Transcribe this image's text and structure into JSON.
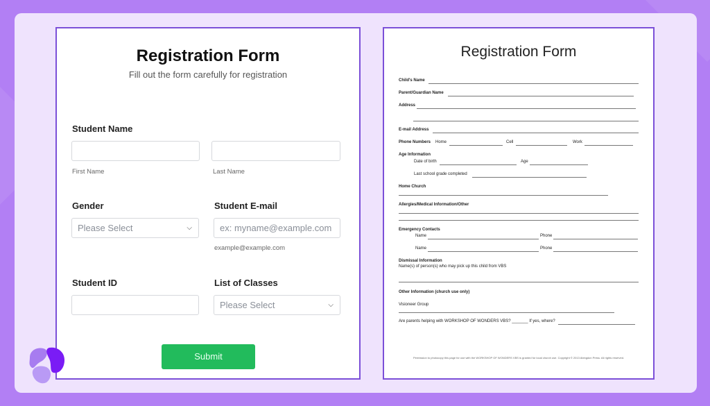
{
  "online_form": {
    "title": "Registration Form",
    "subtitle": "Fill out the form carefully for registration",
    "student_name": {
      "label": "Student Name",
      "first_hint": "First Name",
      "last_hint": "Last Name"
    },
    "gender": {
      "label": "Gender",
      "value": "Please Select"
    },
    "email": {
      "label": "Student E-mail",
      "placeholder": "ex: myname@example.com",
      "hint": "example@example.com"
    },
    "student_id": {
      "label": "Student ID"
    },
    "classes": {
      "label": "List of Classes",
      "value": "Please Select"
    },
    "submit_label": "Submit"
  },
  "paper_form": {
    "title": "Registration Form",
    "childs_name": "Child's Name",
    "guardian_name": "Parent/Guardian Name",
    "address": "Address",
    "email_address": "E-mail Address",
    "phone_numbers": "Phone Numbers",
    "home": "Home",
    "cell": "Cell",
    "work": "Work",
    "age_information": "Age Information",
    "date_of_birth": "Date of birth",
    "age": "Age",
    "last_grade": "Last school grade completed",
    "home_church": "Home Church",
    "allergies": "Allergies/Medical Information/Other",
    "emergency_contacts": "Emergency Contacts",
    "name": "Name",
    "phone": "Phone",
    "dismissal": "Dismissal Information",
    "dismissal_desc": "Name(s) of person(s) who may pick up this child from VBS",
    "other_info": "Other Information (church use only)",
    "visioneer_group": "Visioneer Group",
    "parents_helping": "Are parents helping with WORKSHOP OF WONDERS VBS? _______  If yes, where?",
    "footer": "Permission to photocopy this page for use with the WORKSHOP OF WONDERS VBS is granted for local church use. Copyright © 2013 Abingdon Press. All rights reserved."
  },
  "brand": {
    "logo_icon": "brand-logo-icon",
    "accent": "#7b4fd8"
  }
}
